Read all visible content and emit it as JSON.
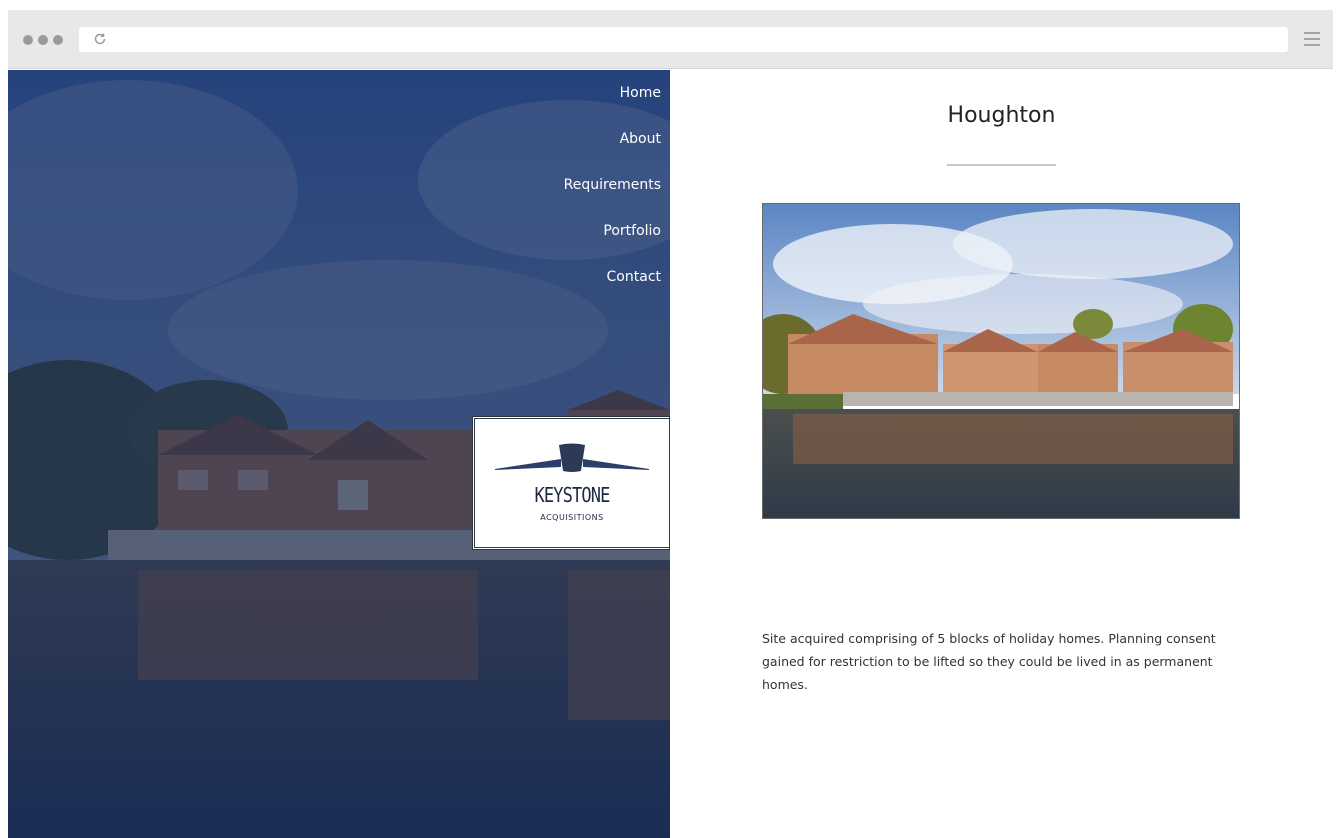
{
  "browser": {
    "reload_icon": "reload-icon",
    "menu_icon": "hamburger-menu-icon"
  },
  "nav": {
    "items": [
      {
        "label": "Home"
      },
      {
        "label": "About"
      },
      {
        "label": "Requirements"
      },
      {
        "label": "Portfolio"
      },
      {
        "label": "Contact"
      }
    ]
  },
  "logo": {
    "word": "KEYSTONE",
    "sub": "ACQUISITIONS"
  },
  "main": {
    "title": "Houghton",
    "description": "Site acquired comprising of 5 blocks of holiday homes. Planning consent gained for restriction to be lifted so they could be lived in as permanent homes."
  },
  "colors": {
    "overlay": "#1c3566",
    "text_dark": "#222222",
    "rule": "#c8c8c8"
  }
}
